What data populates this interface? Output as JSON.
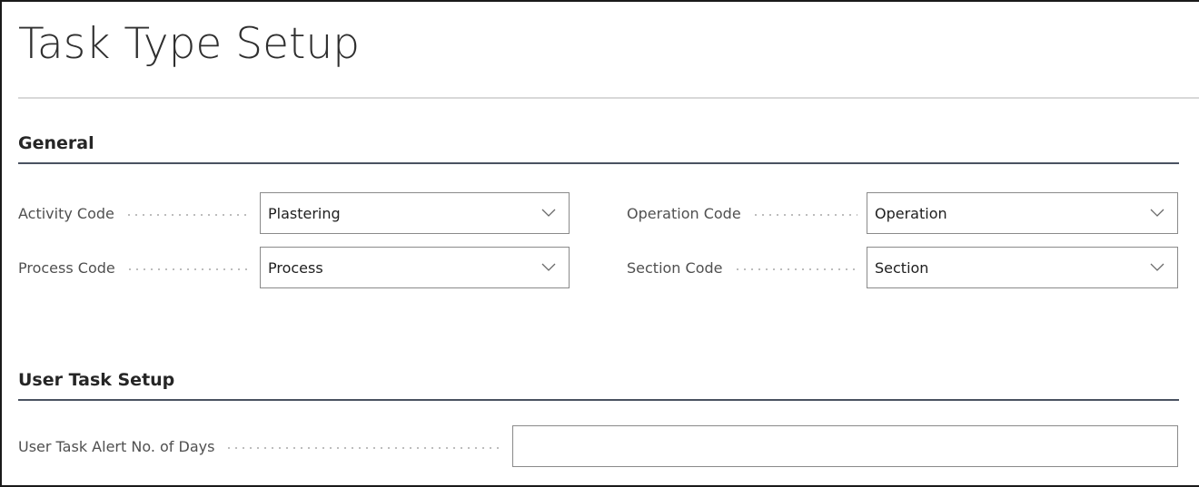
{
  "page": {
    "title": "Task Type Setup"
  },
  "general": {
    "header": "General",
    "activity_code": {
      "label": "Activity Code",
      "value": "Plastering"
    },
    "process_code": {
      "label": "Process Code",
      "value": "Process"
    },
    "operation_code": {
      "label": "Operation Code",
      "value": "Operation"
    },
    "section_code": {
      "label": "Section Code",
      "value": "Section"
    }
  },
  "user_task_setup": {
    "header": "User Task Setup",
    "alert_days": {
      "label": "User Task Alert No. of Days",
      "value": ""
    }
  },
  "icons": {
    "dropdown": "chevron-down-icon"
  },
  "colors": {
    "section_rule": "#4a5261",
    "input_border": "#8a8a8a",
    "label_text": "#505050"
  }
}
